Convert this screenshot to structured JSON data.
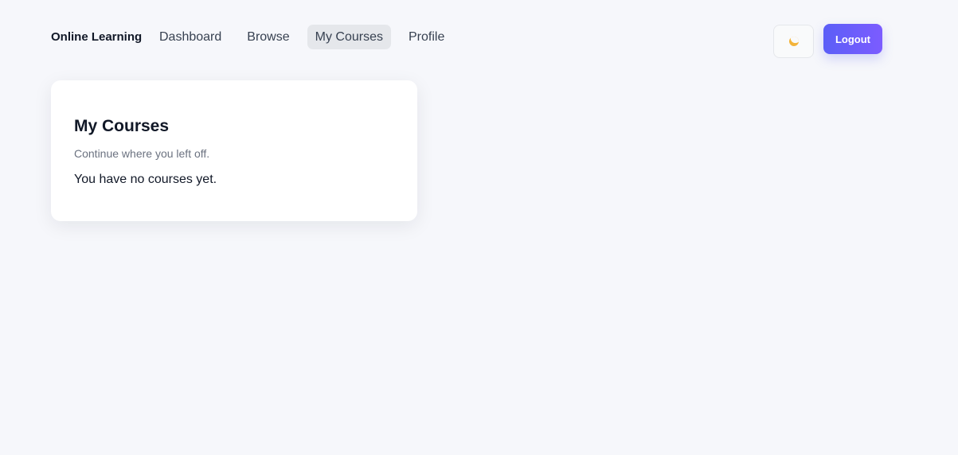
{
  "header": {
    "brand": "Online Learning",
    "nav": [
      {
        "label": "Dashboard",
        "active": false
      },
      {
        "label": "Browse",
        "active": false
      },
      {
        "label": "My Courses",
        "active": true
      },
      {
        "label": "Profile",
        "active": false
      }
    ],
    "theme_toggle_icon": "moon-icon",
    "logout_label": "Logout"
  },
  "main": {
    "title": "My Courses",
    "subtitle": "Continue where you left off.",
    "empty_message": "You have no courses yet."
  },
  "colors": {
    "accent": "#6366f1",
    "background": "#f6f7fb",
    "active_nav": "#e5e7eb"
  }
}
